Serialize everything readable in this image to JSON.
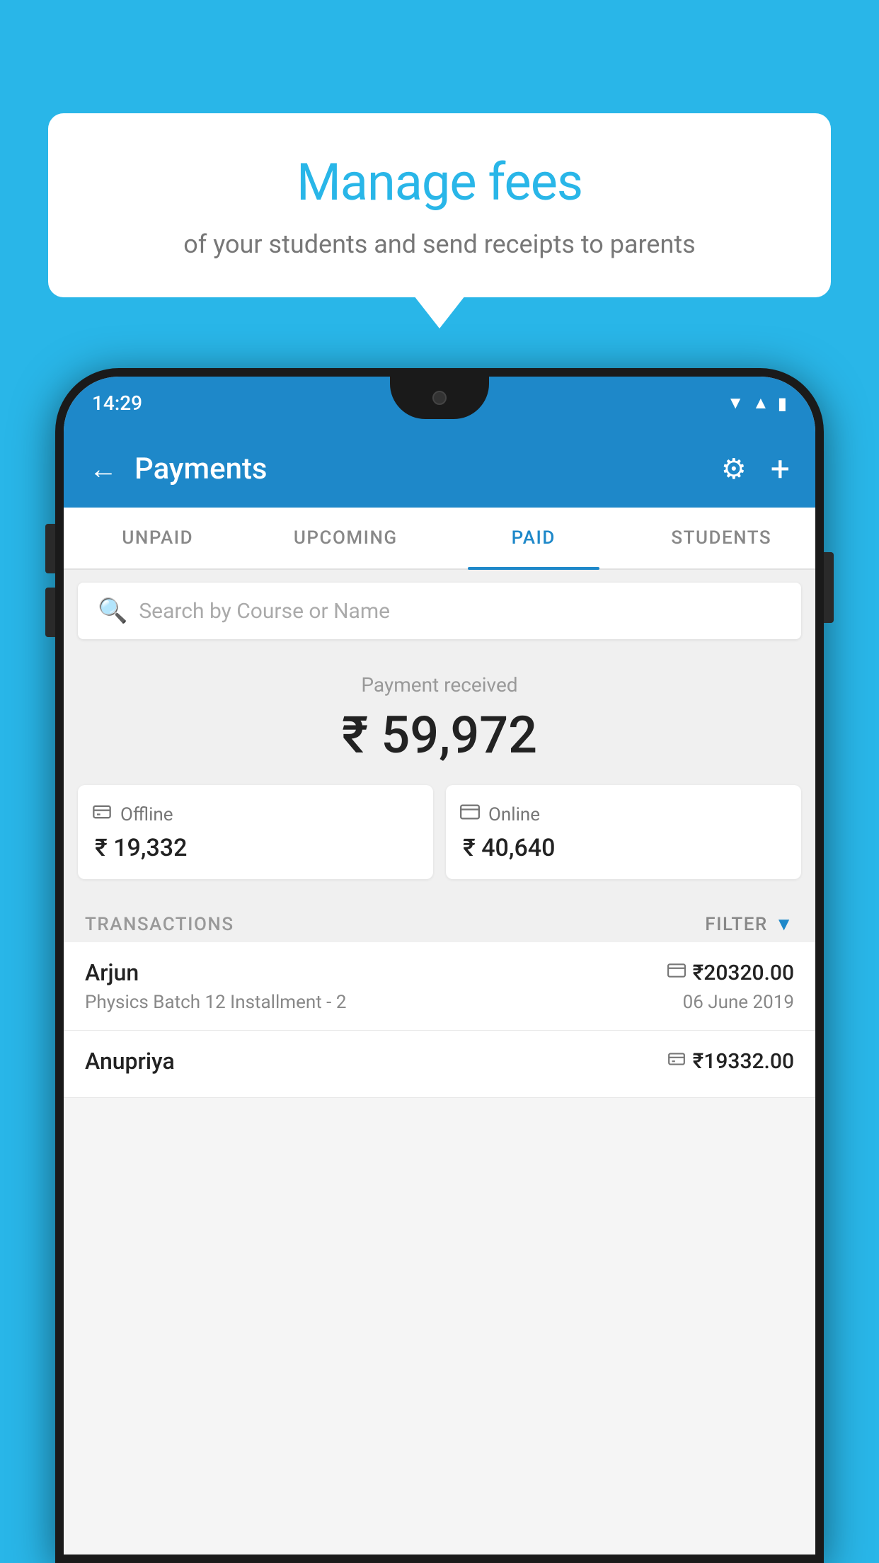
{
  "background_color": "#29B6E8",
  "speech_bubble": {
    "title": "Manage fees",
    "subtitle": "of your students and send receipts to parents"
  },
  "status_bar": {
    "time": "14:29",
    "icons": [
      "wifi",
      "signal",
      "battery"
    ]
  },
  "header": {
    "title": "Payments",
    "back_label": "←",
    "settings_label": "⚙",
    "add_label": "+"
  },
  "tabs": [
    {
      "label": "UNPAID",
      "active": false
    },
    {
      "label": "UPCOMING",
      "active": false
    },
    {
      "label": "PAID",
      "active": true
    },
    {
      "label": "STUDENTS",
      "active": false
    }
  ],
  "search": {
    "placeholder": "Search by Course or Name"
  },
  "payment_summary": {
    "label": "Payment received",
    "amount": "₹ 59,972",
    "offline_label": "Offline",
    "offline_amount": "₹ 19,332",
    "online_label": "Online",
    "online_amount": "₹ 40,640"
  },
  "transactions": {
    "section_label": "TRANSACTIONS",
    "filter_label": "FILTER",
    "items": [
      {
        "name": "Arjun",
        "amount": "₹20320.00",
        "course": "Physics Batch 12 Installment - 2",
        "date": "06 June 2019",
        "payment_type": "online"
      },
      {
        "name": "Anupriya",
        "amount": "₹19332.00",
        "course": "",
        "date": "",
        "payment_type": "offline"
      }
    ]
  }
}
